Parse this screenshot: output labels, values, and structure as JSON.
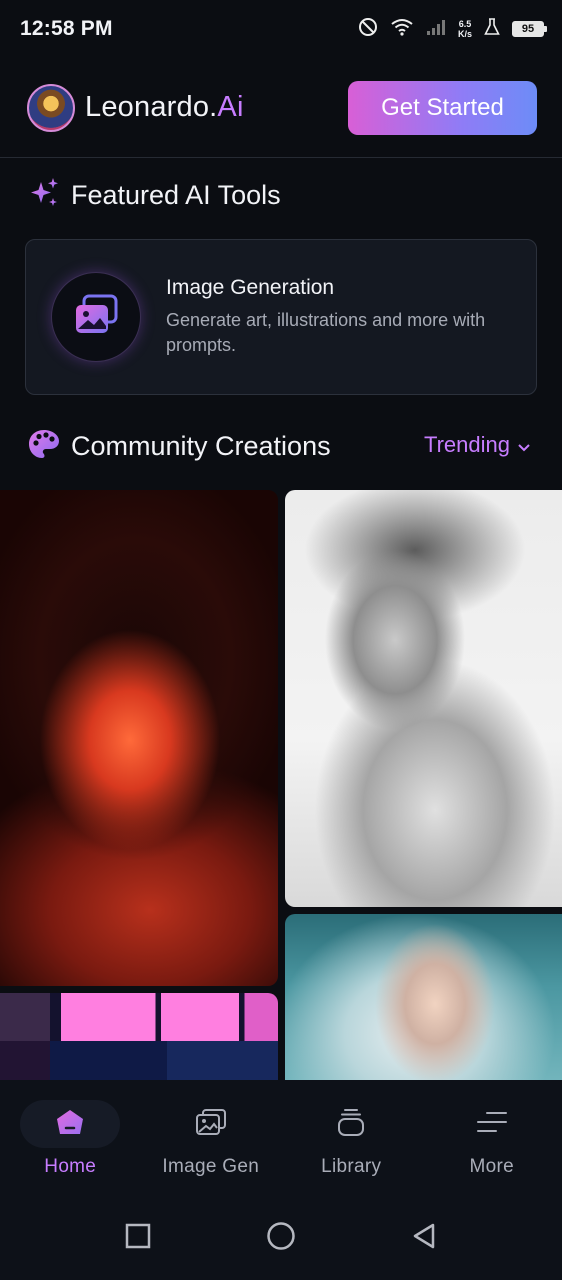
{
  "status_bar": {
    "time": "12:58 PM",
    "net_speed_value": "6.5",
    "net_speed_unit": "K/s",
    "battery": "95"
  },
  "header": {
    "brand_main": "Leonardo.",
    "brand_ai": "Ai",
    "cta_label": "Get Started"
  },
  "featured": {
    "title": "Featured AI Tools",
    "tools": [
      {
        "title": "Image Generation",
        "description": "Generate art, illustrations and more with prompts."
      }
    ]
  },
  "community": {
    "title": "Community Creations",
    "filter_label": "Trending"
  },
  "bottom_nav": {
    "items": [
      {
        "label": "Home",
        "icon": "home-icon",
        "active": true
      },
      {
        "label": "Image Gen",
        "icon": "image-gen-icon",
        "active": false
      },
      {
        "label": "Library",
        "icon": "library-icon",
        "active": false
      },
      {
        "label": "More",
        "icon": "menu-icon",
        "active": false
      }
    ]
  },
  "colors": {
    "background": "#0b0d12",
    "accent": "#c77dff",
    "cta_gradient_start": "#d85fd6",
    "cta_gradient_end": "#6d8cf7"
  }
}
